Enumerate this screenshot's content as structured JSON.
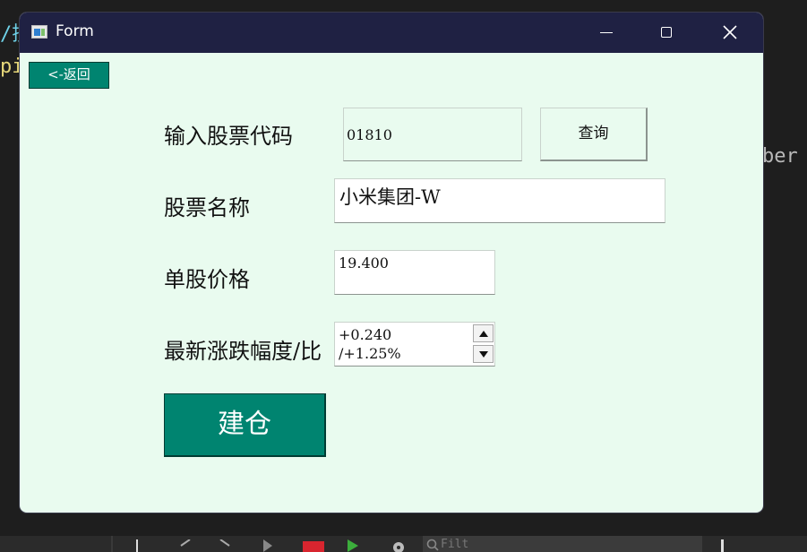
{
  "background": {
    "code_line_1": "/搜",
    "code_line_2": "pi",
    "code_fragment": "ber",
    "taskbar_search_placeholder": "Filt"
  },
  "window": {
    "title": "Form",
    "icon": "app-window-icon",
    "controls": [
      "minimize-icon",
      "maximize-icon",
      "close-icon"
    ]
  },
  "form": {
    "back_label": "<-返回",
    "code_label": "输入股票代码",
    "code_value": "01810",
    "query_label": "查询",
    "name_label": "股票名称",
    "name_value": "小米集团-W",
    "price_label": "单股价格",
    "price_value": "19.400",
    "change_label": "最新涨跌幅度/比",
    "change_line1": "+0.240",
    "change_line2": "/+1.25%",
    "build_label": "建仓"
  },
  "colors": {
    "titlebar": "#1f2143",
    "window_bg": "#e9fbef",
    "accent_button": "#008470"
  }
}
